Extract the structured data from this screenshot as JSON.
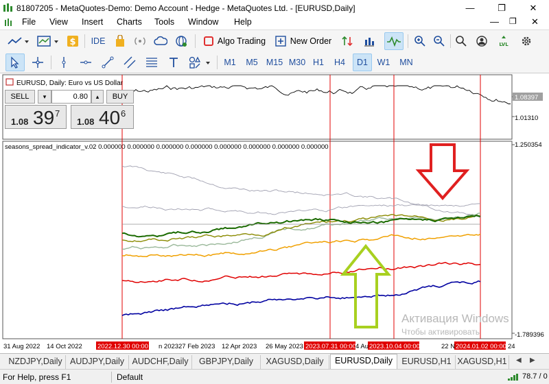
{
  "window": {
    "title": "81807205 - MetaQuotes-Demo: Demo Account - Hedge - MetaQuotes Ltd. - [EURUSD,Daily]"
  },
  "menu": [
    "File",
    "View",
    "Insert",
    "Charts",
    "Tools",
    "Window",
    "Help"
  ],
  "toolbar": {
    "ide_label": "IDE",
    "algo_trading_label": "Algo Trading",
    "new_order_label": "New Order",
    "timeframes": [
      "M1",
      "M5",
      "M15",
      "M30",
      "H1",
      "H4",
      "D1",
      "W1",
      "MN"
    ],
    "active_timeframe": "D1"
  },
  "chart": {
    "symbol_label": "EURUSD, Daily:  Euro vs US Dollar",
    "price_current": "1.08397",
    "price_level": "1.01310",
    "indicator_label": "seasons_spread_indicator_v.02 0.000000 0.000000 0.000000 0.000000 0.000000 0.000000 0.000000 0.000000",
    "indicator_max": "1.250354",
    "indicator_min": "-1.789396",
    "x_labels": [
      "31 Aug 2022",
      "14 Oct 2022",
      "n 2023",
      "27 Feb 2023",
      "12 Apr 2023",
      "26 May 2023",
      "4 Au",
      "22 N",
      "24"
    ],
    "vline_labels": [
      "2022.12.30 00:00",
      "2023.07.31 00:00",
      "2023.10.04 00:00",
      "2024.01.02 00:00"
    ],
    "colors": {
      "vline": "#e00000",
      "series_green": "#1a6a00",
      "series_olive": "#8a8a00",
      "series_lightgreen": "#9ab89a",
      "series_orange": "#f0a000",
      "series_red": "#e00000",
      "series_blue": "#0000a0",
      "series_gray": "#a0a0b0",
      "arrow_down": "#e02020",
      "arrow_up": "#a8d020"
    }
  },
  "trade": {
    "sell_label": "SELL",
    "buy_label": "BUY",
    "volume": "0.80",
    "bid_small": "1.08",
    "bid_big": "39",
    "bid_sup": "7",
    "ask_small": "1.08",
    "ask_big": "40",
    "ask_sup": "6"
  },
  "tabs": [
    "NZDJPY,Daily",
    "AUDJPY,Daily",
    "AUDCHF,Daily",
    "GBPJPY,Daily",
    "XAGUSD,Daily",
    "EURUSD,Daily",
    "EURUSD,H1",
    "XAGUSD,H1"
  ],
  "active_tab": "EURUSD,Daily",
  "watermark": {
    "line1": "Активация Windows",
    "line2": "Чтобы активировать"
  },
  "status": {
    "help": "For Help, press F1",
    "profile": "Default",
    "ping": "78.7 / 0"
  }
}
